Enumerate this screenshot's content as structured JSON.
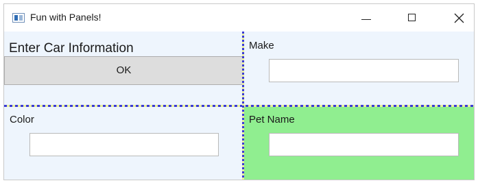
{
  "window": {
    "title": "Fun with Panels!"
  },
  "top_left": {
    "heading": "Enter Car Information",
    "ok_label": "OK"
  },
  "top_right": {
    "label": "Make",
    "value": "",
    "placeholder": ""
  },
  "bottom_left": {
    "label": "Color",
    "value": "",
    "placeholder": ""
  },
  "bottom_right": {
    "label": "Pet Name",
    "value": "",
    "placeholder": "",
    "background": "#90ee90"
  },
  "colors": {
    "panel_background": "#eef5fd",
    "splitter_dash": "#3b3bd6",
    "splitter_gap": "#e9ef9a",
    "button_background": "#dddddd"
  },
  "icons": {
    "app": "app-window-icon",
    "minimize": "minimize-icon",
    "maximize": "maximize-icon",
    "close": "close-icon"
  }
}
